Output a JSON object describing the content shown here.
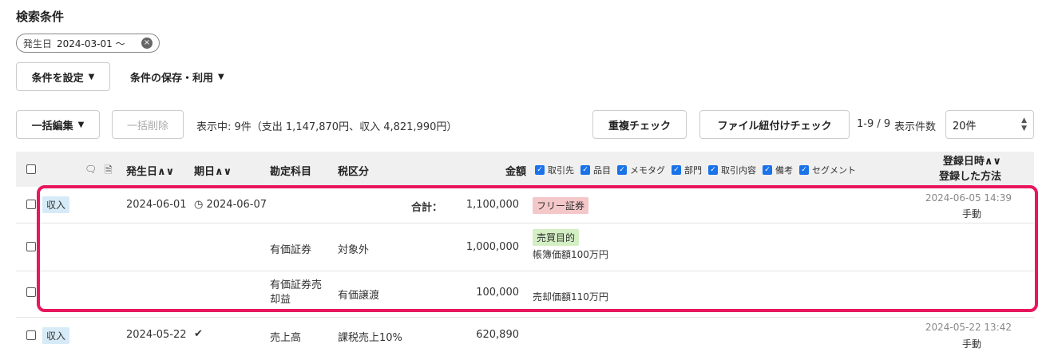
{
  "search": {
    "heading": "検索条件",
    "chip_label": "発生日",
    "chip_value": "2024-03-01 〜",
    "chip_close": "×"
  },
  "toolbar": {
    "set_conditions": "条件を設定",
    "save_use": "条件の保存・利用",
    "bulk_edit": "一括編集",
    "bulk_delete": "一括削除",
    "status": "表示中: 9件（支出 1,147,870円、収入 4,821,990円）",
    "duplicate_check": "重複チェック",
    "file_check": "ファイル紐付けチェック",
    "range": "1-9 / 9",
    "per_page_label": "表示件数",
    "per_page_value": "20件"
  },
  "table": {
    "headers": {
      "date": "発生日",
      "due": "期日",
      "account": "勘定科目",
      "tax": "税区分",
      "amount": "金額",
      "registered": "登録日時",
      "method": "登録した方法",
      "sort": "∧∨"
    },
    "column_options": [
      "取引先",
      "品目",
      "メモタグ",
      "部門",
      "取引内容",
      "備考",
      "セグメント"
    ],
    "rows": [
      {
        "type": "収入",
        "date": "2024-06-01",
        "due": "2024-06-07",
        "total_label": "合計：",
        "amount": "1,100,000",
        "tag": "フリー証券",
        "reg_time": "2024-06-05 14:39",
        "reg_method": "手動"
      },
      {
        "account": "有価証券",
        "tax": "対象外",
        "amount": "1,000,000",
        "tag": "売買目的",
        "memo": "帳簿価額100万円"
      },
      {
        "account_line1": "有価証券売",
        "account_line2": "却益",
        "tax": "有価譲渡",
        "amount": "100,000",
        "memo": "売却価額110万円"
      },
      {
        "type": "収入",
        "date": "2024-05-22",
        "account": "売上高",
        "tax": "課税売上10%",
        "amount": "620,890",
        "reg_time": "2024-05-22 13:42",
        "reg_method": "手動"
      }
    ]
  }
}
